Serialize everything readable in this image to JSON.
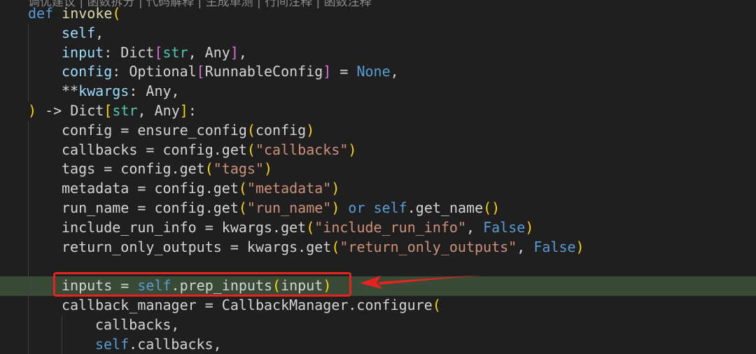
{
  "codelens": "调优建议 | 函数拆分 | 代码解释 | 生成单测 | 行间注释 | 函数注释",
  "highlight_line": 14,
  "colors": {
    "background": "#1f1f1f",
    "highlight": "#394a37",
    "annotation": "#e8231f"
  },
  "lines": [
    {
      "indent": 0,
      "tokens": [
        [
          "kw",
          "def "
        ],
        [
          "fn",
          "invoke"
        ],
        [
          "p1",
          "("
        ]
      ]
    },
    {
      "indent": 1,
      "tokens": [
        [
          "param",
          "self"
        ],
        [
          "plain",
          ","
        ]
      ]
    },
    {
      "indent": 1,
      "tokens": [
        [
          "param",
          "input"
        ],
        [
          "plain",
          ": Dict"
        ],
        [
          "p2",
          "["
        ],
        [
          "type",
          "str"
        ],
        [
          "plain",
          ", Any"
        ],
        [
          "p2",
          "]"
        ],
        [
          "plain",
          ","
        ]
      ]
    },
    {
      "indent": 1,
      "tokens": [
        [
          "param",
          "config"
        ],
        [
          "plain",
          ": Optional"
        ],
        [
          "p2",
          "["
        ],
        [
          "plain",
          "RunnableConfig"
        ],
        [
          "p2",
          "]"
        ],
        [
          "plain",
          " = "
        ],
        [
          "kw",
          "None"
        ],
        [
          "plain",
          ","
        ]
      ]
    },
    {
      "indent": 1,
      "tokens": [
        [
          "plain",
          "**"
        ],
        [
          "param",
          "kwargs"
        ],
        [
          "plain",
          ": Any,"
        ]
      ]
    },
    {
      "indent": 0,
      "tokens": [
        [
          "p1",
          ")"
        ],
        [
          "plain",
          " -> Dict"
        ],
        [
          "p1",
          "["
        ],
        [
          "type",
          "str"
        ],
        [
          "plain",
          ", Any"
        ],
        [
          "p1",
          "]"
        ],
        [
          "plain",
          ":"
        ]
      ]
    },
    {
      "indent": 1,
      "tokens": [
        [
          "plain",
          "config = ensure_config"
        ],
        [
          "p1",
          "("
        ],
        [
          "plain",
          "config"
        ],
        [
          "p1",
          ")"
        ]
      ]
    },
    {
      "indent": 1,
      "tokens": [
        [
          "plain",
          "callbacks = config.get"
        ],
        [
          "p1",
          "("
        ],
        [
          "str",
          "\"callbacks\""
        ],
        [
          "p1",
          ")"
        ]
      ]
    },
    {
      "indent": 1,
      "tokens": [
        [
          "plain",
          "tags = config.get"
        ],
        [
          "p1",
          "("
        ],
        [
          "str",
          "\"tags\""
        ],
        [
          "p1",
          ")"
        ]
      ]
    },
    {
      "indent": 1,
      "tokens": [
        [
          "plain",
          "metadata = config.get"
        ],
        [
          "p1",
          "("
        ],
        [
          "str",
          "\"metadata\""
        ],
        [
          "p1",
          ")"
        ]
      ]
    },
    {
      "indent": 1,
      "tokens": [
        [
          "plain",
          "run_name = config.get"
        ],
        [
          "p1",
          "("
        ],
        [
          "str",
          "\"run_name\""
        ],
        [
          "p1",
          ")"
        ],
        [
          "kw",
          " or "
        ],
        [
          "self",
          "self"
        ],
        [
          "plain",
          ".get_name"
        ],
        [
          "p1",
          "()"
        ]
      ]
    },
    {
      "indent": 1,
      "tokens": [
        [
          "plain",
          "include_run_info = kwargs.get"
        ],
        [
          "p1",
          "("
        ],
        [
          "str",
          "\"include_run_info\""
        ],
        [
          "plain",
          ", "
        ],
        [
          "kw",
          "False"
        ],
        [
          "p1",
          ")"
        ]
      ]
    },
    {
      "indent": 1,
      "tokens": [
        [
          "plain",
          "return_only_outputs = kwargs.get"
        ],
        [
          "p1",
          "("
        ],
        [
          "str",
          "\"return_only_outputs\""
        ],
        [
          "plain",
          ", "
        ],
        [
          "kw",
          "False"
        ],
        [
          "p1",
          ")"
        ]
      ]
    },
    {
      "indent": 1,
      "tokens": []
    },
    {
      "indent": 1,
      "tokens": [
        [
          "plain",
          "inputs = "
        ],
        [
          "self",
          "self"
        ],
        [
          "plain",
          ".prep_inputs"
        ],
        [
          "p1",
          "("
        ],
        [
          "plain",
          "input"
        ],
        [
          "p1",
          ")"
        ]
      ]
    },
    {
      "indent": 1,
      "tokens": [
        [
          "plain",
          "callback_manager = CallbackManager.configure"
        ],
        [
          "p1",
          "("
        ]
      ]
    },
    {
      "indent": 2,
      "tokens": [
        [
          "plain",
          "callbacks,"
        ]
      ]
    },
    {
      "indent": 2,
      "tokens": [
        [
          "self",
          "self"
        ],
        [
          "plain",
          ".callbacks,"
        ]
      ]
    }
  ]
}
